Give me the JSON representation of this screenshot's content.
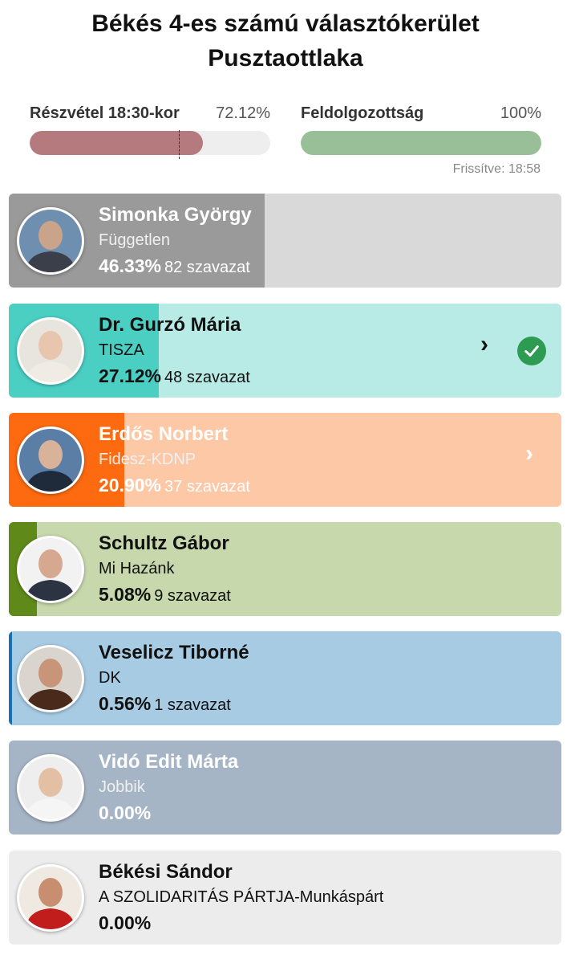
{
  "header": {
    "title_line1": "Békés 4-es számú választókerület",
    "title_line2": "Pusztaottlaka"
  },
  "turnout": {
    "label": "Részvétel 18:30-kor",
    "value_text": "72.12%",
    "fraction": 0.7212,
    "color": "#b47a7e"
  },
  "processed": {
    "label": "Feldolgozottság",
    "value_text": "100%",
    "fraction": 1.0,
    "color": "#98bf98"
  },
  "updated": "Frissítve: 18:58",
  "candidates": [
    {
      "name": "Simonka György",
      "party": "Független",
      "pct": "46.33%",
      "votes": "82 szavazat",
      "fraction": 0.4633,
      "bar_color": "#9a9a9a",
      "bg_color": "#d9d9d9",
      "text": "light",
      "chevron": false,
      "winner": false
    },
    {
      "name": "Dr. Gurzó Mária",
      "party": "TISZA",
      "pct": "27.12%",
      "votes": "48 szavazat",
      "fraction": 0.2712,
      "bar_color": "#4bcfc3",
      "bg_color": "#b9ebe6",
      "text": "dark",
      "chevron": true,
      "winner": true
    },
    {
      "name": "Erdős Norbert",
      "party": "Fidesz-KDNP",
      "pct": "20.90%",
      "votes": "37 szavazat",
      "fraction": 0.209,
      "bar_color": "#fd6a10",
      "bg_color": "#fdc8a5",
      "text": "light",
      "chevron": true,
      "winner": false
    },
    {
      "name": "Schultz Gábor",
      "party": "Mi Hazánk",
      "pct": "5.08%",
      "votes": "9 szavazat",
      "fraction": 0.0508,
      "bar_color": "#5f8a1a",
      "bg_color": "#c7d8ad",
      "text": "dark",
      "chevron": false,
      "winner": false
    },
    {
      "name": "Veselicz Tiborné",
      "party": "DK",
      "pct": "0.56%",
      "votes": "1 szavazat",
      "fraction": 0.0056,
      "bar_color": "#1a6fb0",
      "bg_color": "#a8cbe4",
      "text": "dark",
      "chevron": false,
      "winner": false
    },
    {
      "name": "Vidó Edit Márta",
      "party": "Jobbik",
      "pct": "0.00%",
      "votes": "",
      "fraction": 0.0,
      "bar_color": "#7f8fa6",
      "bg_color": "#a6b5c6",
      "text": "light",
      "chevron": false,
      "winner": false
    },
    {
      "name": "Békési Sándor",
      "party": "A SZOLIDARITÁS PÁRTJA-Munkáspárt",
      "pct": "0.00%",
      "votes": "",
      "fraction": 0.0,
      "bar_color": "#cccccc",
      "bg_color": "#ececec",
      "text": "dark",
      "chevron": false,
      "winner": false
    }
  ]
}
